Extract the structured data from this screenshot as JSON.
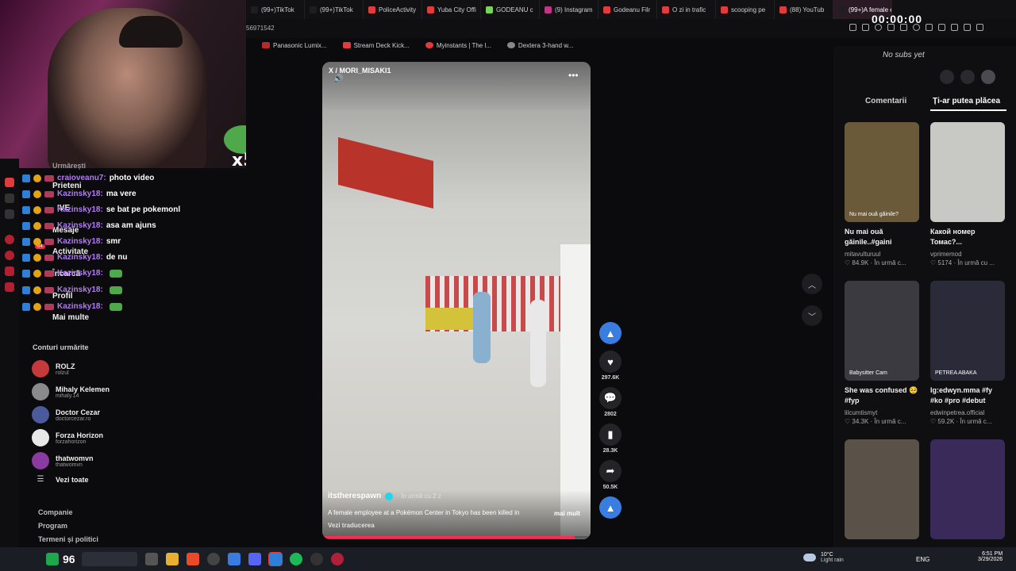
{
  "browser": {
    "tabs": [
      {
        "label": "(99+)TikTok",
        "color": "#1e1e1e"
      },
      {
        "label": "(99+)TikTok",
        "color": "#1e1e1e"
      },
      {
        "label": "PoliceActivity",
        "color": "#e23b3b"
      },
      {
        "label": "Yuba City Offi",
        "color": "#e23b3b"
      },
      {
        "label": "GODEANU c",
        "color": "#7bd35a"
      },
      {
        "label": "(9) Instagram",
        "color": "#c13584"
      },
      {
        "label": "Godeanu Filr",
        "color": "#e23b3b"
      },
      {
        "label": "O zi in trafic",
        "color": "#e23b3b"
      },
      {
        "label": "scooping pe",
        "color": "#e23b3b"
      },
      {
        "label": "(88) YouTub",
        "color": "#e23b3b"
      },
      {
        "label": "(99+)A female em",
        "color": "#1e1e1e"
      }
    ],
    "url_fragment": "56971542",
    "timer": "00:00:00",
    "bookmarks": [
      "Panasonic Lumix...",
      "Stream Deck Kick...",
      "Myinstants | The l...",
      "Dextera 3-hand w..."
    ]
  },
  "webcam": {
    "emote_label": "x5"
  },
  "chat": [
    {
      "user": "craioveanu7:",
      "msg": "photo video"
    },
    {
      "user": "Kazinsky18:",
      "msg": "ma vere"
    },
    {
      "user": "Kazinsky18:",
      "msg": "se bat pe pokemonl"
    },
    {
      "user": "Kazinsky18:",
      "msg": "asa am ajuns"
    },
    {
      "user": "Kazinsky18:",
      "msg": "smr"
    },
    {
      "user": "Kazinsky18:",
      "msg": "de nu"
    },
    {
      "user": "Kazinsky18:",
      "msg": ""
    },
    {
      "user": "Kazinsky18:",
      "msg": ""
    },
    {
      "user": "Kazinsky18:",
      "msg": ""
    }
  ],
  "leftnav": {
    "urmaresti": "Urmărești",
    "prieteni": "Prieteni",
    "live": "IVE",
    "mesaje": "Mesaje",
    "activitate": "Activitate",
    "incarca": "Încarcă",
    "profil": "Profil",
    "mai_multe": "Mai multe",
    "badge": "64"
  },
  "following": {
    "header": "Conturi urmărite",
    "accounts": [
      {
        "name": "ROLZ",
        "handle": "rolzul",
        "color": "#c43a3a"
      },
      {
        "name": "Mihaly Kelemen",
        "handle": "mihaly.14",
        "color": "#8a8a8a"
      },
      {
        "name": "Doctor Cezar",
        "handle": "doctorcezar.ro",
        "color": "#4a5a9a"
      },
      {
        "name": "Forza Horizon",
        "handle": "forzahorizon",
        "color": "#e8e8e8"
      },
      {
        "name": "thatwomvn",
        "handle": "thatwomvn",
        "color": "#8a3aa0"
      }
    ],
    "see_all": "Vezi toate"
  },
  "footer_links": [
    "Companie",
    "Program",
    "Termeni și politici"
  ],
  "video": {
    "watermark": "X / MORI_MISAKI1",
    "author": "itstherespawn",
    "time": "· În urmă cu 2 z",
    "caption": "A female employee at a Pokémon Center in Tokyo has been killed in",
    "more": "mai mult",
    "translate": "Vezi traducerea",
    "likes": "297.6K",
    "comments": "2802",
    "saves": "28.3K",
    "shares": "50.5K"
  },
  "rightpanel": {
    "subs": "No subs yet",
    "tab_comments": "Comentarii",
    "tab_like": "Ți-ar putea plăcea",
    "cards": [
      {
        "title": "Nu mai ouă găinile..#gaini",
        "author": "mitavulturuul",
        "views": "84.9K",
        "when": "· În urmă c...",
        "thumb": "#6b5a3a",
        "overlay": "Nu mai ouă găinile?"
      },
      {
        "title": "Какой номер Томас?...",
        "author": "vprimemod",
        "views": "5174",
        "when": "· În urmă cu ...",
        "thumb": "#c8c8c4",
        "overlay": ""
      },
      {
        "title": "She was confused 🥺 #fyp",
        "author": "lilcumtismyt",
        "views": "34.3K",
        "when": "· În urmă c...",
        "thumb": "#3a3a40",
        "overlay": "Babysitter Cam"
      },
      {
        "title": "Ig:edwyn.mma #fy #ko #pro #debut",
        "author": "edwinpetrea.official",
        "views": "59.2K",
        "when": "· În urmă c...",
        "thumb": "#2a2a38",
        "overlay": "PETREA  ABAKA"
      },
      {
        "title": "",
        "author": "",
        "views": "",
        "when": "",
        "thumb": "#5a5248",
        "overlay": ""
      },
      {
        "title": "",
        "author": "",
        "views": "",
        "when": "",
        "thumb": "#3a2a5a",
        "overlay": ""
      }
    ]
  },
  "taskbar": {
    "score": "96",
    "weather_temp": "10°C",
    "weather_desc": "Light rain",
    "lang": "ENG",
    "time": "6:51 PM",
    "date": "3/29/2026"
  }
}
